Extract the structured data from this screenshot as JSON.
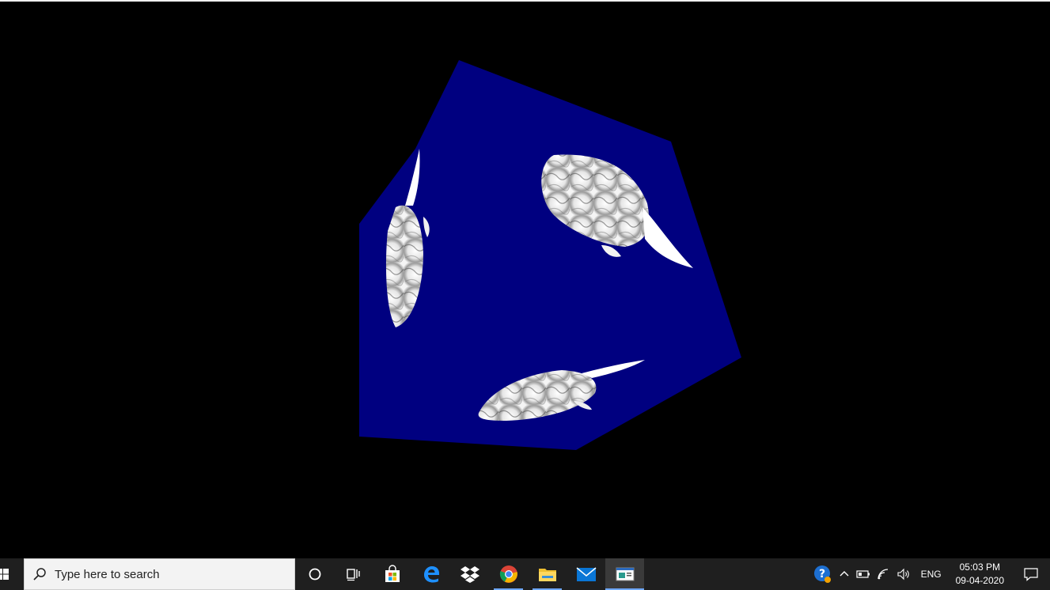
{
  "scene": {
    "object": "rotating cube",
    "face_color": "#000080",
    "background_color": "#000000",
    "texture": "white marble fish"
  },
  "taskbar": {
    "search_placeholder": "Type here to search",
    "apps": [
      {
        "name": "cortana",
        "icon": "circle-icon",
        "state": "idle"
      },
      {
        "name": "task-view",
        "icon": "task-view-icon",
        "state": "idle"
      },
      {
        "name": "store",
        "icon": "store-bag-icon",
        "state": "idle"
      },
      {
        "name": "edge",
        "icon": "edge-icon",
        "state": "idle"
      },
      {
        "name": "dropbox",
        "icon": "dropbox-icon",
        "state": "idle"
      },
      {
        "name": "chrome",
        "icon": "chrome-icon",
        "state": "running"
      },
      {
        "name": "file-explorer",
        "icon": "folder-icon",
        "state": "running"
      },
      {
        "name": "mail",
        "icon": "mail-icon",
        "state": "idle"
      },
      {
        "name": "app-window",
        "icon": "app-window-icon",
        "state": "active"
      }
    ],
    "tray": {
      "language": "ENG",
      "time": "05:03 PM",
      "date": "09-04-2020"
    },
    "accent_color": "#6ea8ff"
  }
}
